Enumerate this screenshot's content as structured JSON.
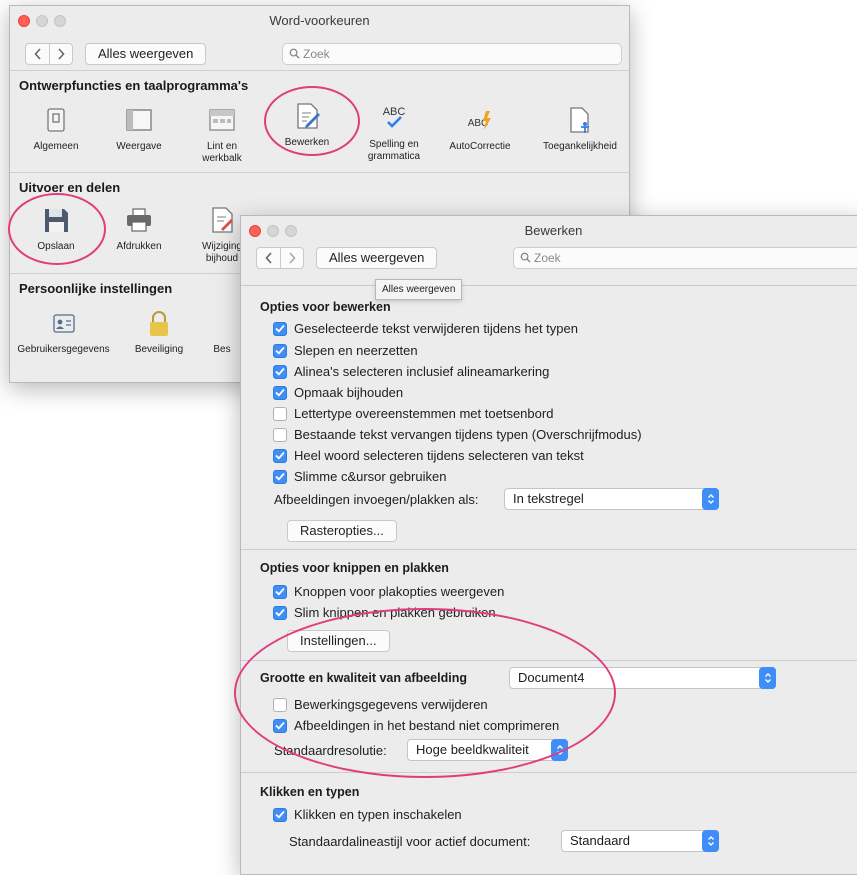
{
  "prefs_window": {
    "title": "Word-voorkeuren",
    "show_all_label": "Alles weergeven",
    "search_placeholder": "Zoek",
    "sections": [
      {
        "heading": "Ontwerpfuncties en taalprogramma's",
        "items": [
          {
            "label": "Algemeen",
            "icon": "general-icon"
          },
          {
            "label": "Weergave",
            "icon": "view-icon"
          },
          {
            "label": "Lint en\nwerkbalk",
            "icon": "ribbon-icon"
          },
          {
            "label": "Bewerken",
            "icon": "edit-icon"
          },
          {
            "label": "Spelling en\ngrammatica",
            "icon": "spelling-icon"
          },
          {
            "label": "AutoCorrectie",
            "icon": "autocorrect-icon"
          },
          {
            "label": "Toegankelijkheid",
            "icon": "accessibility-icon"
          }
        ]
      },
      {
        "heading": "Uitvoer en delen",
        "items": [
          {
            "label": "Opslaan",
            "icon": "save-icon"
          },
          {
            "label": "Afdrukken",
            "icon": "print-icon"
          },
          {
            "label": "Wijziging\nbijhoud",
            "icon": "track-changes-icon"
          }
        ]
      },
      {
        "heading": "Persoonlijke instellingen",
        "items": [
          {
            "label": "Gebruikersgegevens",
            "icon": "user-info-icon"
          },
          {
            "label": "Beveiliging",
            "icon": "lock-icon"
          },
          {
            "label": "Bes",
            "icon": "file-locations-icon"
          }
        ]
      }
    ]
  },
  "edit_window": {
    "title": "Bewerken",
    "show_all_label": "Alles weergeven",
    "search_placeholder": "Zoek",
    "tooltip": "Alles weergeven",
    "editing_options": {
      "title": "Opties voor bewerken",
      "options": [
        {
          "label": "Geselecteerde tekst verwijderen tijdens het typen",
          "checked": true
        },
        {
          "label": "Slepen en neerzetten",
          "checked": true
        },
        {
          "label": "Alinea's selecteren inclusief alineamarkering",
          "checked": true
        },
        {
          "label": "Opmaak bijhouden",
          "checked": true
        },
        {
          "label": "Lettertype overeenstemmen met toetsenbord",
          "checked": false
        },
        {
          "label": "Bestaande tekst vervangen tijdens typen (Overschrijfmodus)",
          "checked": false
        },
        {
          "label": "Heel woord selecteren tijdens selecteren van tekst",
          "checked": true
        },
        {
          "label": "Slimme c&ursor gebruiken",
          "checked": true
        }
      ],
      "insert_label": "Afbeeldingen invoegen/plakken als:",
      "insert_value": "In tekstregel",
      "grid_button": "Rasteropties..."
    },
    "cut_paste": {
      "title": "Opties voor knippen en plakken",
      "options": [
        {
          "label": "Knoppen voor plakopties weergeven",
          "checked": true
        },
        {
          "label": "Slim knippen en plakken gebruiken",
          "checked": true
        }
      ],
      "settings_button": "Instellingen..."
    },
    "image_quality": {
      "title": "Grootte en kwaliteit van afbeelding",
      "document_value": "Document4",
      "options": [
        {
          "label": "Bewerkingsgegevens verwijderen",
          "checked": false
        },
        {
          "label": "Afbeeldingen in het bestand niet comprimeren",
          "checked": true
        }
      ],
      "resolution_label": "Standaardresolutie:",
      "resolution_value": "Hoge beeldkwaliteit"
    },
    "click_type": {
      "title": "Klikken en typen",
      "options": [
        {
          "label": "Klikken en typen inschakelen",
          "checked": true
        }
      ],
      "style_label": "Standaardalineastijl voor actief document:",
      "style_value": "Standaard"
    }
  },
  "colors": {
    "checkbox_on": "#3f8ef7",
    "annotation": "#e03c7e",
    "close_button": "#ff5f57"
  }
}
